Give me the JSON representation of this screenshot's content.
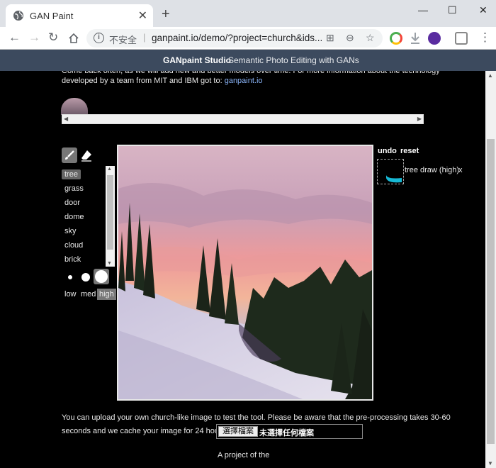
{
  "browser": {
    "tab_title": "GAN Paint",
    "insecure_label": "不安全",
    "url": "ganpaint.io/demo/?project=church&ids..."
  },
  "site": {
    "brand": "GANpaint Studio",
    "tagline": "Semantic Photo Editing with GANs"
  },
  "intro": {
    "line1_partial": "Come back often, as we will add new and better models over time. For more information about the technology",
    "line2": "developed by a team from MIT and IBM got to:",
    "link": "ganpaint.io"
  },
  "labels": [
    "tree",
    "grass",
    "door",
    "dome",
    "sky",
    "cloud",
    "brick"
  ],
  "selected_label": "tree",
  "sizes": [
    "low",
    "med",
    "high"
  ],
  "selected_size": "high",
  "history": {
    "undo": "undo",
    "reset": "reset",
    "entry": "tree draw (high)",
    "remove": "x"
  },
  "upload": {
    "line1": "You can upload your own church-like image to test the tool. Please be aware that the pre-processing takes 30-60",
    "line2": "seconds and we cache your image for 24 hours :",
    "button": "選擇檔案",
    "status": "未選擇任何檔案"
  },
  "footer": {
    "project_of": "A project of the"
  },
  "colors": {
    "site_header": "#3c4a5e",
    "link": "#8ab4f8",
    "history_stroke": "#17b8d4"
  }
}
